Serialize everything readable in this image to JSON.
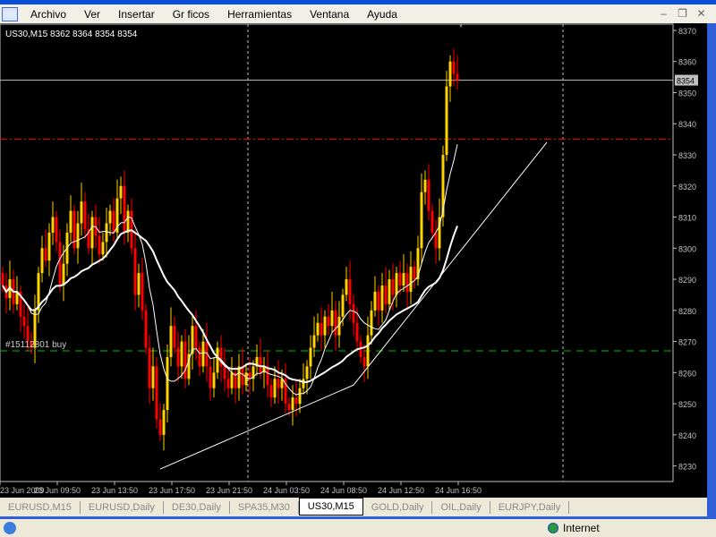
{
  "menu": {
    "items": [
      "Archivo",
      "Ver",
      "Insertar",
      "Gr ficos",
      "Herramientas",
      "Ventana",
      "Ayuda"
    ]
  },
  "window_buttons": {
    "minimize": "–",
    "restore": "❐",
    "close": "✕"
  },
  "chart_header": "US30,M15  8362 8364 8354 8354",
  "order_label": "#15112801 buy",
  "current_price_label": "8354",
  "tabs": [
    {
      "label": "EURUSD,M15",
      "active": false
    },
    {
      "label": "EURUSD,Daily",
      "active": false
    },
    {
      "label": "DE30,Daily",
      "active": false
    },
    {
      "label": "SPA35,M30",
      "active": false
    },
    {
      "label": "US30,M15",
      "active": true
    },
    {
      "label": "GOLD,Daily",
      "active": false
    },
    {
      "label": "OIL,Daily",
      "active": false
    },
    {
      "label": "EURJPY,Daily",
      "active": false
    }
  ],
  "status": {
    "zone": "Internet"
  },
  "colors": {
    "bull": "#ffd400",
    "bear": "#ff0000",
    "background": "#000000",
    "grid": "#c0c0c0",
    "stop_line": "#ff0000",
    "entry_line": "#00c000"
  },
  "chart_data": {
    "type": "candlestick",
    "symbol": "US30",
    "timeframe": "M15",
    "ylim": [
      8225,
      8372
    ],
    "y_ticks": [
      8230,
      8240,
      8250,
      8260,
      8270,
      8280,
      8290,
      8300,
      8310,
      8320,
      8330,
      8340,
      8350,
      8360,
      8370
    ],
    "x_tick_labels": [
      "23 Jun 2009",
      "23 Jun 09:50",
      "23 Jun 13:50",
      "23 Jun 17:50",
      "23 Jun 21:50",
      "24 Jun 03:50",
      "24 Jun 08:50",
      "24 Jun 12:50",
      "24 Jun 16:50"
    ],
    "bars_per_tick": 16,
    "closes": [
      8288,
      8284,
      8290,
      8282,
      8286,
      8278,
      8275,
      8270,
      8268,
      8280,
      8292,
      8300,
      8296,
      8305,
      8310,
      8302,
      8288,
      8295,
      8305,
      8312,
      8300,
      8308,
      8315,
      8306,
      8300,
      8310,
      8304,
      8298,
      8302,
      8308,
      8312,
      8305,
      8316,
      8320,
      8305,
      8312,
      8300,
      8285,
      8292,
      8280,
      8268,
      8255,
      8262,
      8245,
      8240,
      8248,
      8265,
      8275,
      8268,
      8262,
      8270,
      8258,
      8266,
      8275,
      8268,
      8262,
      8270,
      8262,
      8255,
      8260,
      8268,
      8262,
      8258,
      8255,
      8260,
      8255,
      8262,
      8256,
      8260,
      8258,
      8262,
      8265,
      8260,
      8262,
      8256,
      8252,
      8258,
      8255,
      8258,
      8250,
      8248,
      8252,
      8250,
      8255,
      8258,
      8262,
      8268,
      8272,
      8276,
      8272,
      8278,
      8275,
      8280,
      8272,
      8278,
      8285,
      8290,
      8282,
      8276,
      8270,
      8265,
      8262,
      8272,
      8280,
      8286,
      8280,
      8288,
      8282,
      8290,
      8285,
      8292,
      8288,
      8292,
      8286,
      8294,
      8290,
      8300,
      8318,
      8322,
      8312,
      8305,
      8300,
      8310,
      8330,
      8352,
      8360,
      8356,
      8354
    ],
    "first_open": 8292,
    "moving_averages": [
      {
        "period": 8,
        "style": "thin"
      },
      {
        "period": 24,
        "style": "thick"
      }
    ],
    "horizontal_lines": [
      {
        "price": 8335,
        "color": "#ff0000",
        "style": "dash-dot"
      },
      {
        "price": 8267,
        "color": "#00c000",
        "style": "dashed"
      },
      {
        "price": 8354,
        "color": "#c0c0c0",
        "style": "solid"
      }
    ],
    "trendlines": [
      {
        "points": [
          {
            "bar": 44,
            "price": 8229
          },
          {
            "bar": 98,
            "price": 8256
          },
          {
            "bar": 152,
            "price": 8334
          }
        ]
      }
    ]
  }
}
